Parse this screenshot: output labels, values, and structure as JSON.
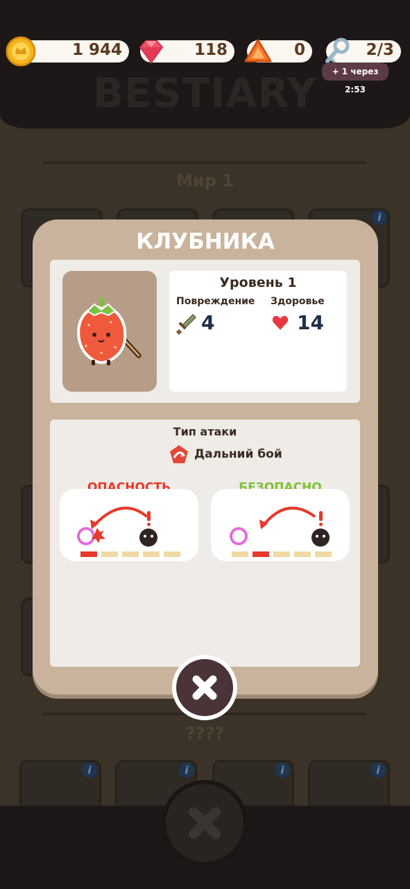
{
  "resources": {
    "coins": "1 944",
    "gems": "118",
    "tokens": "0",
    "keys": "2/3",
    "keys_timer": "+ 1 через 2:53"
  },
  "screen_title": "BESTIARY",
  "background": {
    "world_label": "Мир 1",
    "unknown_label": "????"
  },
  "modal": {
    "title": "КЛУБНИКА",
    "level": "Уровень 1",
    "damage_label": "Повреждение",
    "damage_value": "4",
    "health_label": "Здоровье",
    "health_value": "14",
    "attack_type_title": "Тип атаки",
    "attack_type_value": "Дальний бой",
    "danger_label": "ОПАСНОСТЬ",
    "safe_label": "БЕЗОПАСНО"
  },
  "colors": {
    "modal_bg": "#c9b39d",
    "danger": "#e53a2c",
    "safe": "#7fc137"
  },
  "icons": [
    "coin-icon",
    "gem-icon",
    "token-icon",
    "key-icon",
    "sword-icon",
    "heart-icon",
    "ranged-attack-icon",
    "close-icon"
  ]
}
